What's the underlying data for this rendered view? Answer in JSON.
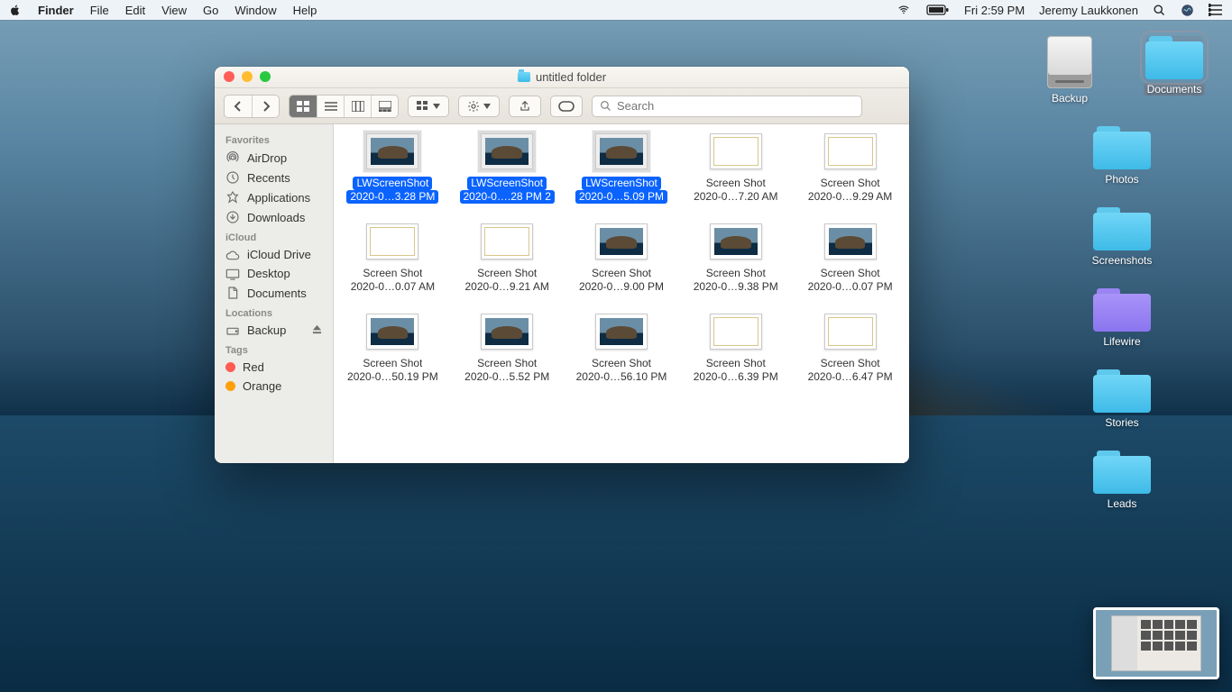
{
  "menubar": {
    "app": "Finder",
    "items": [
      "File",
      "Edit",
      "View",
      "Go",
      "Window",
      "Help"
    ],
    "clock": "Fri 2:59 PM",
    "user": "Jeremy Laukkonen"
  },
  "desktop": {
    "drive": "Backup",
    "folders": [
      "Documents",
      "Photos",
      "Screenshots",
      "Lifewire",
      "Stories",
      "Leads"
    ],
    "selected": "Documents"
  },
  "finder": {
    "title": "untitled folder",
    "search_placeholder": "Search",
    "sidebar": {
      "favorites_hdr": "Favorites",
      "favorites": [
        "AirDrop",
        "Recents",
        "Applications",
        "Downloads"
      ],
      "icloud_hdr": "iCloud",
      "icloud": [
        "iCloud Drive",
        "Desktop",
        "Documents"
      ],
      "locations_hdr": "Locations",
      "locations": [
        "Backup"
      ],
      "tags_hdr": "Tags",
      "tags": [
        {
          "label": "Red",
          "color": "#ff5b51"
        },
        {
          "label": "Orange",
          "color": "#ff9f0a"
        }
      ]
    },
    "files": [
      {
        "l1": "LWScreenShot",
        "l2": "2020-0…3.28 PM",
        "selected": true,
        "thumb": "catalina"
      },
      {
        "l1": "LWScreenShot",
        "l2": "2020-0….28 PM 2",
        "selected": true,
        "thumb": "catalina"
      },
      {
        "l1": "LWScreenShot",
        "l2": "2020-0…5.09 PM",
        "selected": true,
        "thumb": "catalina"
      },
      {
        "l1": "Screen Shot",
        "l2": "2020-0…7.20 AM",
        "selected": false,
        "thumb": "white"
      },
      {
        "l1": "Screen Shot",
        "l2": "2020-0…9.29 AM",
        "selected": false,
        "thumb": "white"
      },
      {
        "l1": "Screen Shot",
        "l2": "2020-0…0.07 AM",
        "selected": false,
        "thumb": "white"
      },
      {
        "l1": "Screen Shot",
        "l2": "2020-0…9.21 AM",
        "selected": false,
        "thumb": "white"
      },
      {
        "l1": "Screen Shot",
        "l2": "2020-0…9.00 PM",
        "selected": false,
        "thumb": "catalina"
      },
      {
        "l1": "Screen Shot",
        "l2": "2020-0…9.38 PM",
        "selected": false,
        "thumb": "catalina"
      },
      {
        "l1": "Screen Shot",
        "l2": "2020-0…0.07 PM",
        "selected": false,
        "thumb": "catalina"
      },
      {
        "l1": "Screen Shot",
        "l2": "2020-0…50.19 PM",
        "selected": false,
        "thumb": "catalina"
      },
      {
        "l1": "Screen Shot",
        "l2": "2020-0…5.52 PM",
        "selected": false,
        "thumb": "catalina"
      },
      {
        "l1": "Screen Shot",
        "l2": "2020-0…56.10 PM",
        "selected": false,
        "thumb": "catalina"
      },
      {
        "l1": "Screen Shot",
        "l2": "2020-0…6.39 PM",
        "selected": false,
        "thumb": "white"
      },
      {
        "l1": "Screen Shot",
        "l2": "2020-0…6.47 PM",
        "selected": false,
        "thumb": "white"
      }
    ]
  }
}
